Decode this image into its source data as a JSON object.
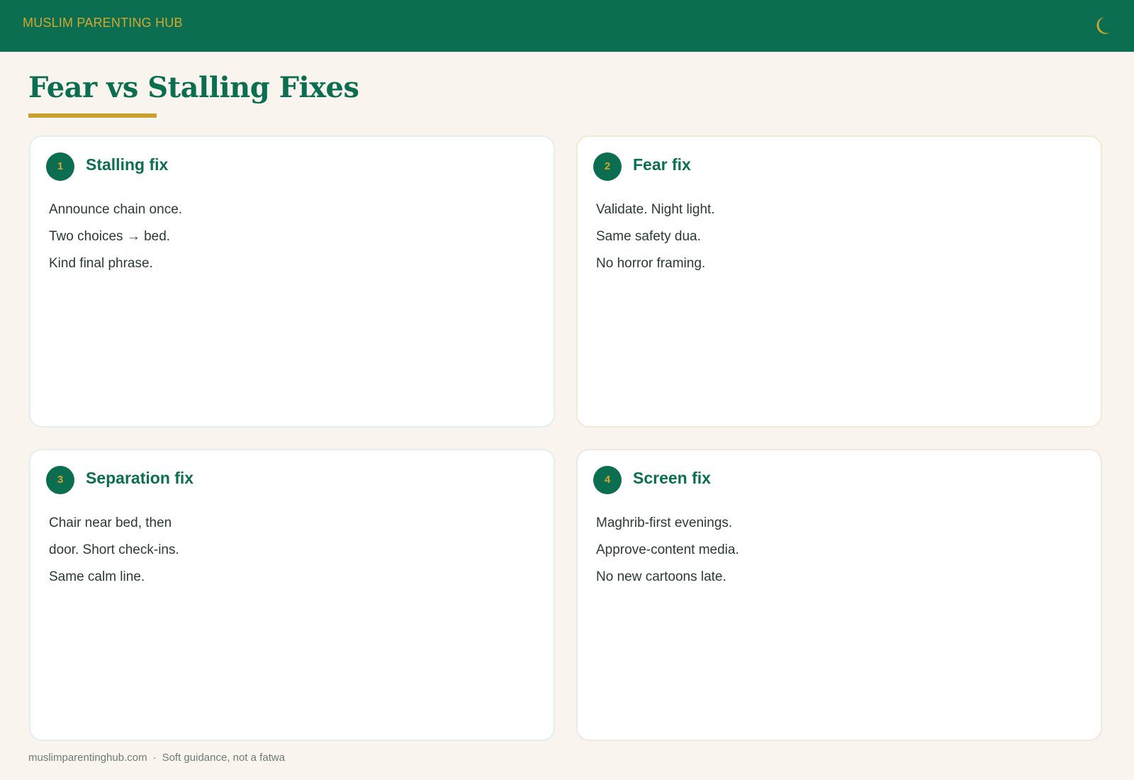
{
  "header": {
    "brand": "MUSLIM PARENTING HUB",
    "icon": "crescent-moon-icon"
  },
  "page": {
    "title": "Fear vs Stalling Fixes"
  },
  "cards": [
    {
      "number": "1",
      "title": "Stalling fix",
      "lines": [
        "Announce chain once.",
        "Two choices → bed.",
        "Kind final phrase."
      ]
    },
    {
      "number": "2",
      "title": "Fear fix",
      "lines": [
        "Validate. Night light.",
        "Same safety dua.",
        "No horror framing."
      ]
    },
    {
      "number": "3",
      "title": "Separation fix",
      "lines": [
        "Chair near bed, then",
        "door. Short check-ins.",
        "Same calm line."
      ]
    },
    {
      "number": "4",
      "title": "Screen fix",
      "lines": [
        "Maghrib-first evenings.",
        "Approve-content media.",
        "No new cartoons late."
      ]
    }
  ],
  "footer": {
    "site": "muslimparentinghub.com",
    "separator": "·",
    "note": "Soft guidance, not a fatwa"
  },
  "colors": {
    "primary_green": "#0c6e51",
    "gold": "#d3a62e",
    "background": "#f9f5ee"
  }
}
